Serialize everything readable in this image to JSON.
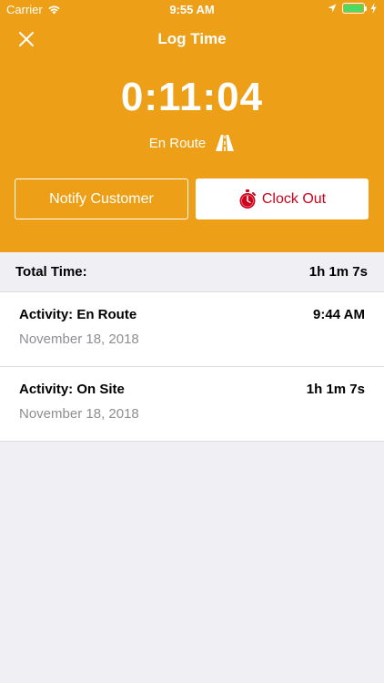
{
  "status_bar": {
    "carrier": "Carrier",
    "time": "9:55 AM"
  },
  "nav": {
    "title": "Log Time",
    "close_icon": "close-icon"
  },
  "timer": {
    "elapsed": "0:11:04",
    "status": "En Route",
    "status_icon": "road-icon"
  },
  "actions": {
    "notify_label": "Notify Customer",
    "clockout_label": "Clock Out",
    "clockout_icon": "stopwatch-icon"
  },
  "summary": {
    "label": "Total Time:",
    "value": "1h 1m 7s"
  },
  "activities": [
    {
      "title": "Activity: En Route",
      "time": "9:44 AM",
      "date": "November 18, 2018"
    },
    {
      "title": "Activity: On Site",
      "time": "1h 1m 7s",
      "date": "November 18, 2018"
    }
  ],
  "colors": {
    "header_bg": "#eda017",
    "clockout_red": "#d0021b",
    "battery_green": "#4cd964",
    "date_gray": "#8e8e93"
  }
}
